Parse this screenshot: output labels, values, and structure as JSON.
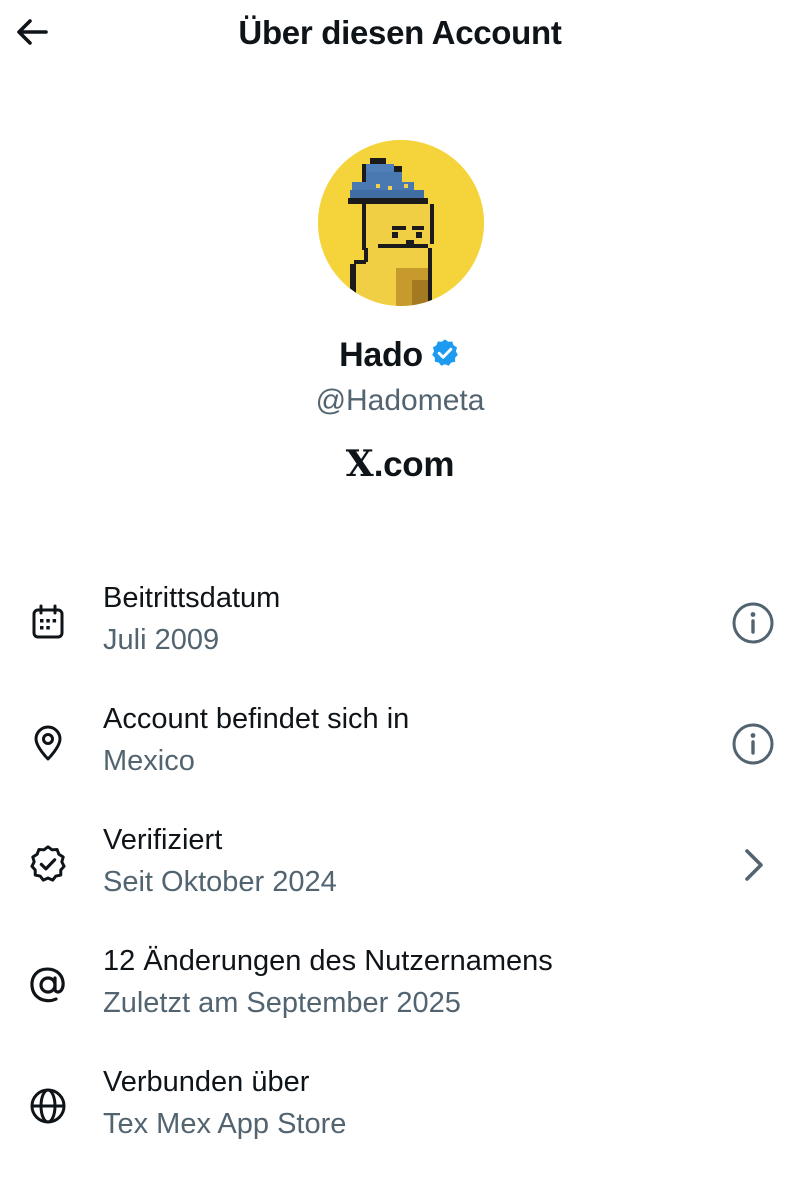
{
  "header": {
    "title": "Über diesen Account",
    "back_icon": "arrow-left-icon"
  },
  "profile": {
    "display_name": "Hado",
    "verified_badge_icon": "verified-badge-icon",
    "verified_color": "#1d9bf0",
    "handle": "@Hadometa",
    "site_logo": "X",
    "site_domain": ".com",
    "avatar_description": "pixel-art character wearing blue wizard hat",
    "avatar_background": "#f5d33a"
  },
  "details": [
    {
      "icon": "calendar-icon",
      "title": "Beitrittsdatum",
      "subtitle": "Juli 2009",
      "action_icon": "info-icon"
    },
    {
      "icon": "location-pin-icon",
      "title": "Account befindet sich in",
      "subtitle": "Mexico",
      "action_icon": "info-icon"
    },
    {
      "icon": "verified-check-icon",
      "title": "Verifiziert",
      "subtitle": "Seit Oktober 2024",
      "action_icon": "chevron-right-icon"
    },
    {
      "icon": "at-sign-icon",
      "title": "12 Änderungen des Nutzernamens",
      "subtitle": "Zuletzt am September 2025"
    },
    {
      "icon": "globe-icon",
      "title": "Verbunden über",
      "subtitle": "Tex Mex App Store"
    }
  ],
  "colors": {
    "text_primary": "#0f1419",
    "text_secondary": "#536471",
    "background": "#ffffff"
  }
}
